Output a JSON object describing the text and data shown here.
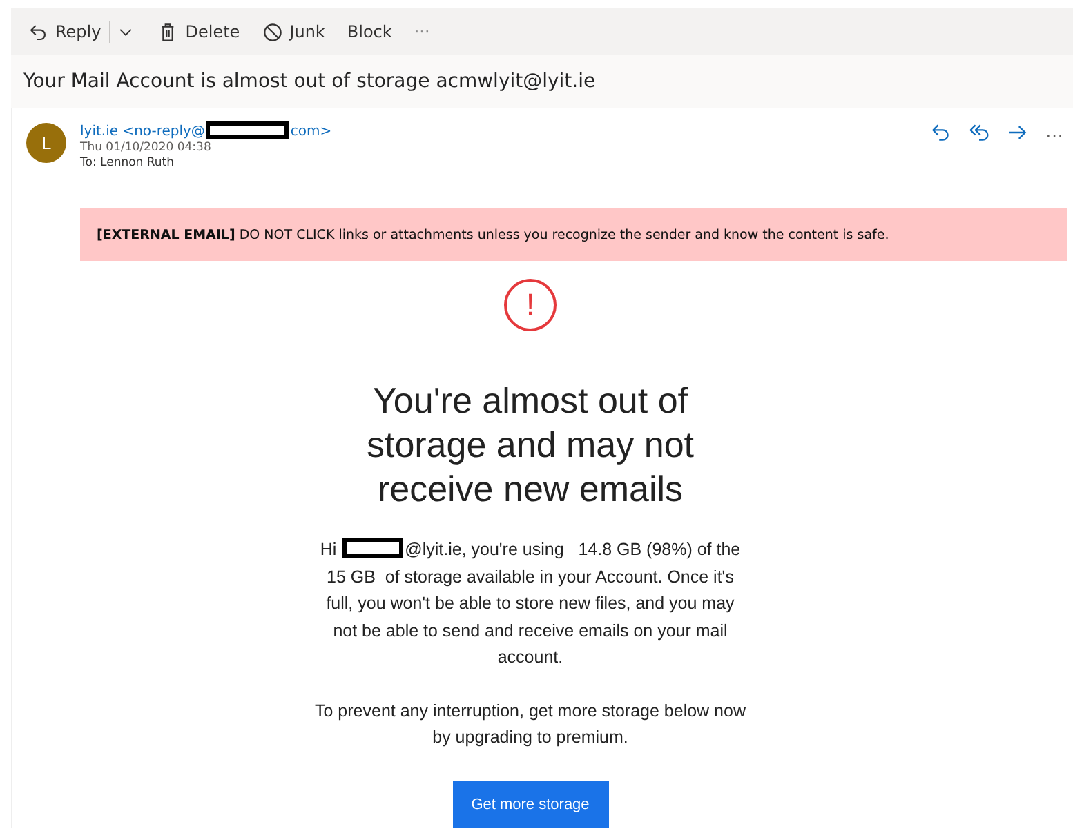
{
  "toolbar": {
    "actions": [
      {
        "kind": "reply",
        "label": "Reply"
      },
      {
        "kind": "dropdown"
      },
      {
        "kind": "delete",
        "label": "Delete"
      },
      {
        "kind": "junk",
        "label": "Junk"
      },
      {
        "kind": "block",
        "label": "Block"
      },
      {
        "kind": "more",
        "label": "···"
      }
    ]
  },
  "subject": "Your Mail Account is almost out of storage acmwlyit@lyit.ie",
  "message": {
    "avatar": "L",
    "sender_before": "lyit.ie <no-reply@",
    "sender_after": "com>",
    "date": "Thu 01/10/2020 04:38",
    "to": "To:  Lennon Ruth",
    "actions": [
      {
        "kind": "reply"
      },
      {
        "kind": "reply-all"
      },
      {
        "kind": "forward"
      },
      {
        "kind": "more",
        "label": "···"
      }
    ],
    "banner": {
      "bold": "[EXTERNAL EMAIL]",
      "text": "DO NOT CLICK links or attachments unless you recognize the sender and know the content is safe."
    },
    "alert_symbol": "!",
    "headline": "You're almost out of storage and may not receive new emails",
    "paragraph_before": "Hi ",
    "paragraph_after": "@lyit.ie, you're using   14.8 GB (98%) of the  15 GB  of storage available in your Account. Once it's full, you won't be able to store new files, and you may not be able to send and receive emails on your mail account.",
    "paragraph_2": "To prevent any interruption, get more storage below now by upgrading to premium.",
    "button": "Get more storage"
  }
}
